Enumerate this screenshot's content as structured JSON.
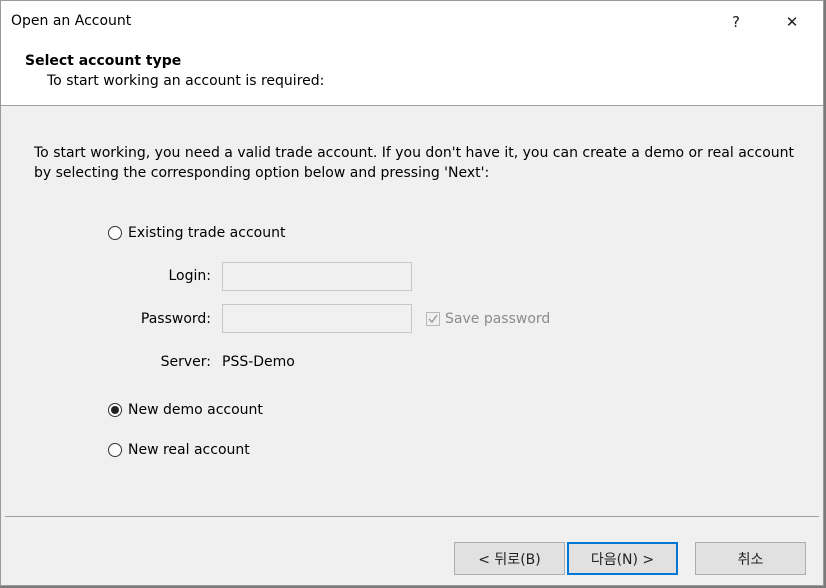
{
  "window": {
    "title": "Open an Account",
    "help_button": "?",
    "close_button": "✕"
  },
  "header": {
    "title": "Select account type",
    "subtitle": "To start working an account is required:"
  },
  "intro": "To start working, you need a valid trade account. If you don't have it, you can create a demo or real account by selecting the corresponding option below and pressing 'Next':",
  "options": {
    "existing": {
      "label": "Existing trade account",
      "selected": false
    },
    "demo": {
      "label": "New demo account",
      "selected": true
    },
    "real": {
      "label": "New real account",
      "selected": false
    }
  },
  "form": {
    "login_label": "Login:",
    "login_value": "",
    "password_label": "Password:",
    "password_value": "",
    "save_password_label": "Save password",
    "save_password_checked": true,
    "server_label": "Server:",
    "server_value": "PSS-Demo"
  },
  "buttons": {
    "back": "< 뒤로(B)",
    "next": "다음(N) >",
    "cancel": "취소"
  }
}
